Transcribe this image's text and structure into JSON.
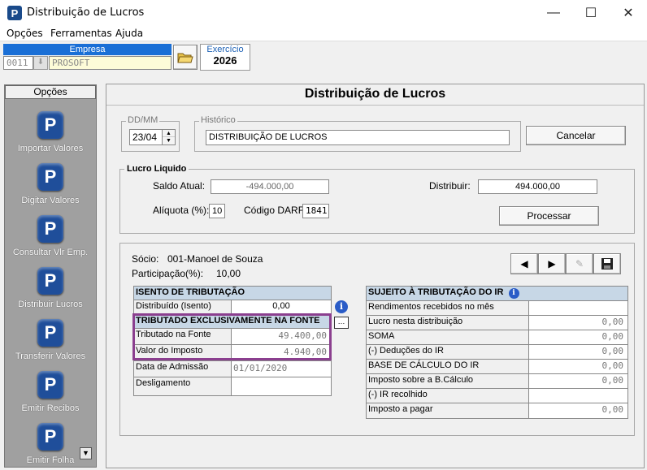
{
  "window": {
    "title": "Distribuição de Lucros",
    "minimize": "—",
    "maximize": "☐",
    "close": "✕"
  },
  "menu": [
    "Opções",
    "Ferramentas",
    "Ajuda"
  ],
  "empresa": {
    "label": "Empresa",
    "code": "0011",
    "name": "PROSOFT"
  },
  "exercicio": {
    "label": "Exercício",
    "year": "2026"
  },
  "sidebar": {
    "title": "Opções",
    "items": [
      {
        "label": "Importar Valores",
        "icon": "p-logo-icon"
      },
      {
        "label": "Digitar Valores",
        "icon": "p-logo-icon"
      },
      {
        "label": "Consultar Vlr Emp.",
        "icon": "p-logo-icon"
      },
      {
        "label": "Distribuir Lucros",
        "icon": "p-logo-icon"
      },
      {
        "label": "Transferir Valores",
        "icon": "p-logo-icon"
      },
      {
        "label": "Emitir Recibos",
        "icon": "p-logo-icon"
      },
      {
        "label": "Emitir Folha",
        "icon": "p-logo-icon"
      }
    ]
  },
  "main": {
    "title": "Distribuição de Lucros"
  },
  "form": {
    "ddmm_label": "DD/MM",
    "ddmm": "23/04",
    "historico_label": "Histórico",
    "historico": "DISTRIBUIÇÃO DE LUCROS",
    "cancel": "Cancelar"
  },
  "lucro": {
    "title": "Lucro Liquido",
    "saldo_label": "Saldo Atual:",
    "saldo": "-494.000,00",
    "distribuir_label": "Distribuir:",
    "distribuir": "494.000,00",
    "aliquota_label": "Alíquota (%):",
    "aliquota": "10",
    "darf_label": "Código DARF:",
    "darf": "1841",
    "processar": "Processar"
  },
  "socio": {
    "label": "Sócio:",
    "value": "001-Manoel de Souza",
    "part_label": "Participação(%):",
    "part": "10,00"
  },
  "left_table": {
    "isento_header": "ISENTO DE TRIBUTAÇÃO",
    "distribuido_label": "Distribuído (Isento)",
    "distribuido": "0,00",
    "tributado_header": "TRIBUTADO EXCLUSIVAMENTE NA FONTE",
    "trib_fonte_label": "Tributado na Fonte",
    "trib_fonte": "49.400,00",
    "imposto_label": "Valor do Imposto",
    "imposto": "4.940,00",
    "admissao_label": "Data de Admissão",
    "admissao": "01/01/2020",
    "desligamento_label": "Desligamento",
    "desligamento": ""
  },
  "right_table": {
    "header": "SUJEITO À TRIBUTAÇÃO DO IR",
    "rows": [
      {
        "label": "Rendimentos recebidos no mês",
        "value": ""
      },
      {
        "label": "Lucro nesta distribuição",
        "value": "0,00"
      },
      {
        "label": "SOMA",
        "value": "0,00"
      },
      {
        "label": "(-) Deduções do IR",
        "value": "0,00"
      },
      {
        "label": "BASE DE CÁLCULO DO IR",
        "value": "0,00"
      },
      {
        "label": "Imposto sobre a B.Cálculo",
        "value": "0,00"
      },
      {
        "label": "(-) IR recolhido",
        "value": ""
      },
      {
        "label": "Imposto a pagar",
        "value": "0,00"
      }
    ]
  },
  "colors": {
    "accent": "#1f4e9a",
    "highlight": "#8b3f8f",
    "header_bg": "#c7d7e6",
    "empresa_bar": "#1a6fd6"
  }
}
